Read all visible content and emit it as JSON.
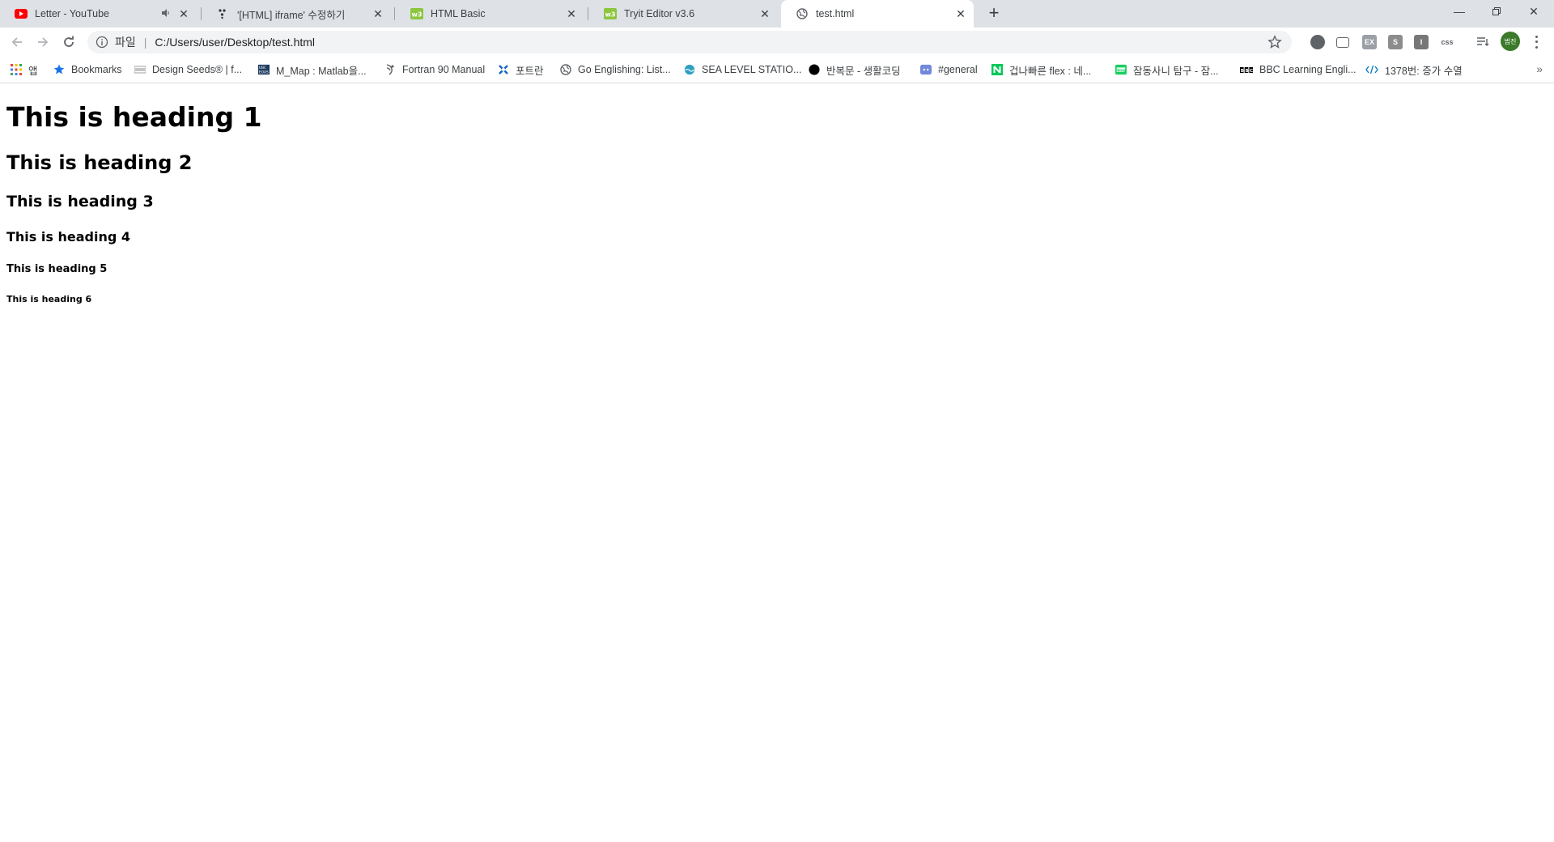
{
  "tabs": [
    {
      "title": "Letter - YouTube",
      "favicon": "youtube-icon",
      "muted": true
    },
    {
      "title": "'[HTML] iframe' 수정하기",
      "favicon": "velog-icon"
    },
    {
      "title": "HTML Basic",
      "favicon": "w3schools-icon"
    },
    {
      "title": "Tryit Editor v3.6",
      "favicon": "w3schools-icon"
    },
    {
      "title": "test.html",
      "favicon": "globe-icon",
      "active": true
    }
  ],
  "toolbar": {
    "scheme_label": "파일",
    "url": "C:/Users/user/Desktop/test.html"
  },
  "profile": {
    "initials": "범진",
    "color": "#3b7a2a"
  },
  "extensions": [
    {
      "name": "extension-circle-icon",
      "label": ""
    },
    {
      "name": "extension-box-icon",
      "label": ""
    },
    {
      "name": "extension-ex-icon",
      "label": "EX"
    },
    {
      "name": "extension-s-icon",
      "label": "S"
    },
    {
      "name": "extension-i-icon",
      "label": "I"
    },
    {
      "name": "extension-css-icon",
      "label": "css"
    }
  ],
  "bookmarks": [
    {
      "label": "앱",
      "icon": "apps-grid-icon"
    },
    {
      "label": "Bookmarks",
      "icon": "star-icon"
    },
    {
      "label": "Design Seeds® | f...",
      "icon": "design-seeds-icon"
    },
    {
      "label": "M_Map : Matlab을...",
      "icon": "unbc-icon"
    },
    {
      "label": "Fortran 90 Manual",
      "icon": "fortran-icon"
    },
    {
      "label": "포트란",
      "icon": "cross-icon"
    },
    {
      "label": "Go Englishing: List...",
      "icon": "globe-icon"
    },
    {
      "label": "SEA LEVEL STATIO...",
      "icon": "sea-level-icon"
    },
    {
      "label": "반복문 - 생활코딩",
      "icon": "black-dot-icon"
    },
    {
      "label": "#general",
      "icon": "discord-icon"
    },
    {
      "label": "겁나빠른 flex : 네...",
      "icon": "naver-icon"
    },
    {
      "label": "잠동사니 탐구 - 잠...",
      "icon": "blog-icon"
    },
    {
      "label": "BBC Learning Engli...",
      "icon": "bbc-icon"
    },
    {
      "label": "1378번: 증가 수열",
      "icon": "code-icon"
    }
  ],
  "headings": {
    "h1": "This is heading 1",
    "h2": "This is heading 2",
    "h3": "This is heading 3",
    "h4": "This is heading 4",
    "h5": "This is heading 5",
    "h6": "This is heading 6"
  }
}
